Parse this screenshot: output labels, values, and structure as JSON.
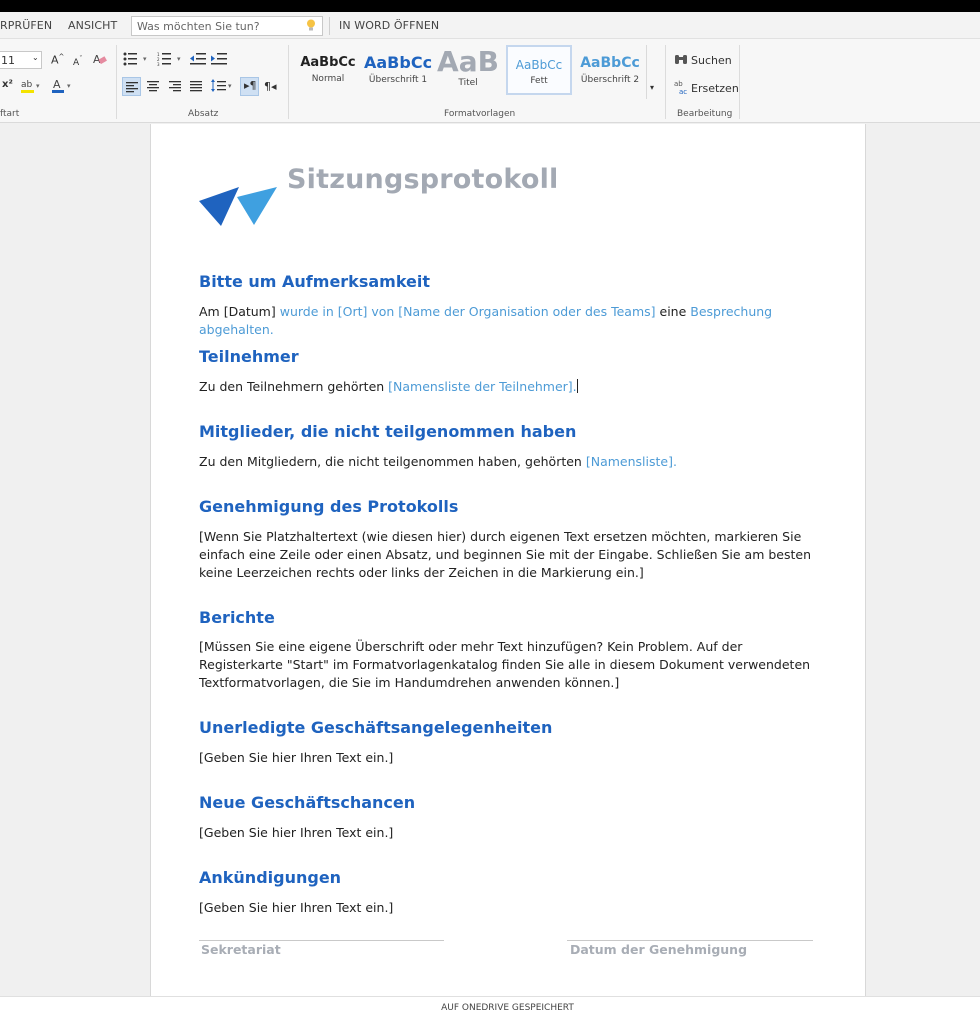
{
  "tabs": {
    "review": "RPRÜFEN",
    "view": "ANSICHT",
    "open_in_word": "IN WORD ÖFFNEN"
  },
  "tellme": {
    "placeholder": "Was möchten Sie tun?"
  },
  "ribbon": {
    "font_size": "11",
    "groups": {
      "font": "ftart",
      "paragraph": "Absatz",
      "styles": "Formatvorlagen",
      "editing": "Bearbeitung"
    },
    "styles": [
      {
        "sample": "AaBbCc",
        "label": "Normal"
      },
      {
        "sample": "AaBbCc",
        "label": "Überschrift 1"
      },
      {
        "sample": "AaB",
        "label": "Titel"
      },
      {
        "sample": "AaBbCc",
        "label": "Fett"
      },
      {
        "sample": "AaBbCc",
        "label": "Überschrift 2"
      }
    ],
    "editing": {
      "find": "Suchen",
      "replace": "Ersetzen"
    }
  },
  "document": {
    "title": "Sitzungsprotokoll",
    "sections": [
      {
        "heading": "Bitte um Aufmerksamkeit"
      },
      {
        "heading": "Teilnehmer"
      },
      {
        "heading": "Mitglieder, die nicht teilgenommen haben"
      },
      {
        "heading": "Genehmigung des Protokolls"
      },
      {
        "heading": "Berichte"
      },
      {
        "heading": "Unerledigte Geschäftsangelegenheiten"
      },
      {
        "heading": "Neue Geschäftschancen"
      },
      {
        "heading": "Ankündigungen"
      }
    ],
    "s1": {
      "a": "Am [Datum] ",
      "b": "wurde in [Ort] von [Name der Organisation oder des Teams]",
      "c": " eine ",
      "d": "Besprechung abgehalten."
    },
    "s2": {
      "a": "Zu den Teilnehmern gehörten ",
      "b": "[Namensliste der Teilnehmer]."
    },
    "s3": {
      "a": "Zu den Mitgliedern, die nicht teilgenommen haben, gehörten ",
      "b": "[Namensliste]."
    },
    "s4_lines": [
      "[Wenn Sie Platzhaltertext (wie diesen hier) durch eigenen Text ersetzen möchten, markieren Sie",
      "einfach eine Zeile oder einen Absatz, und beginnen Sie mit der Eingabe. Schließen Sie am besten",
      "keine Leerzeichen rechts oder links der Zeichen in die Markierung ein.]"
    ],
    "s5_lines": [
      "[Müssen Sie eine eigene Überschrift oder mehr Text hinzufügen? Kein Problem. Auf der",
      "Registerkarte \"Start\" im Formatvorlagenkatalog finden Sie alle in diesem Dokument verwendeten",
      "Textformatvorlagen, die Sie im Handumdrehen anwenden können.]"
    ],
    "s6": "[Geben Sie hier Ihren Text ein.]",
    "s7": "[Geben Sie hier Ihren Text ein.]",
    "s8": "[Geben Sie hier Ihren Text ein.]",
    "signature": {
      "left": "Sekretariat",
      "right": "Datum der Genehmigung"
    }
  },
  "status": "AUF ONEDRIVE GESPEICHERT",
  "colors": {
    "heading": "#1f63bf",
    "placeholder": "#4d9bd6",
    "title": "#a3a9b3"
  }
}
